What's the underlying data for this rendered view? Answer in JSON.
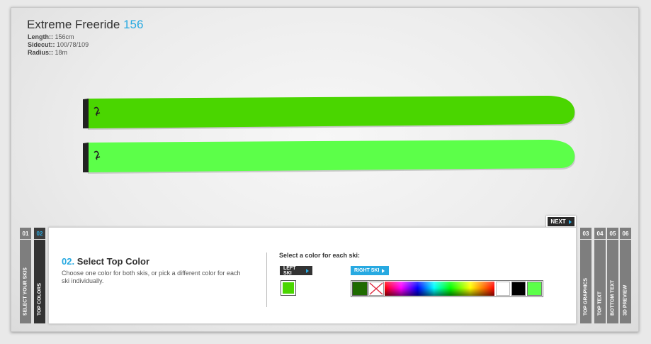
{
  "header": {
    "title": "Extreme Freeride",
    "size": "156",
    "specs": [
      {
        "label": "Length::",
        "value": "156cm"
      },
      {
        "label": "Sidecut::",
        "value": "100/78/109"
      },
      {
        "label": "Radius::",
        "value": "18m"
      }
    ]
  },
  "skis": {
    "left_color": "#4ad600",
    "right_color": "#5cff49",
    "tip_color": "#222222"
  },
  "nav": {
    "next_label": "NEXT",
    "steps": [
      {
        "num": "01",
        "label": "Select your skis"
      },
      {
        "num": "02",
        "label": "Top colors"
      },
      {
        "num": "03",
        "label": "Top graphics"
      },
      {
        "num": "04",
        "label": "Top text"
      },
      {
        "num": "05",
        "label": "Bottom text"
      },
      {
        "num": "06",
        "label": "3D preview"
      }
    ]
  },
  "panel": {
    "step_num": "02.",
    "step_title": "Select Top Color",
    "description": "Choose one color for both skis, or pick a different color for each ski individually.",
    "instruction": "Select a color for each ski:",
    "left_ski_label": "LEFT SKI",
    "right_ski_label": "RIGHT SKI",
    "palette": {
      "current": "#1e6b00",
      "white": "#ffffff",
      "black": "#000000",
      "green": "#5cff49"
    }
  },
  "colors": {
    "accent": "#27a9e1"
  }
}
